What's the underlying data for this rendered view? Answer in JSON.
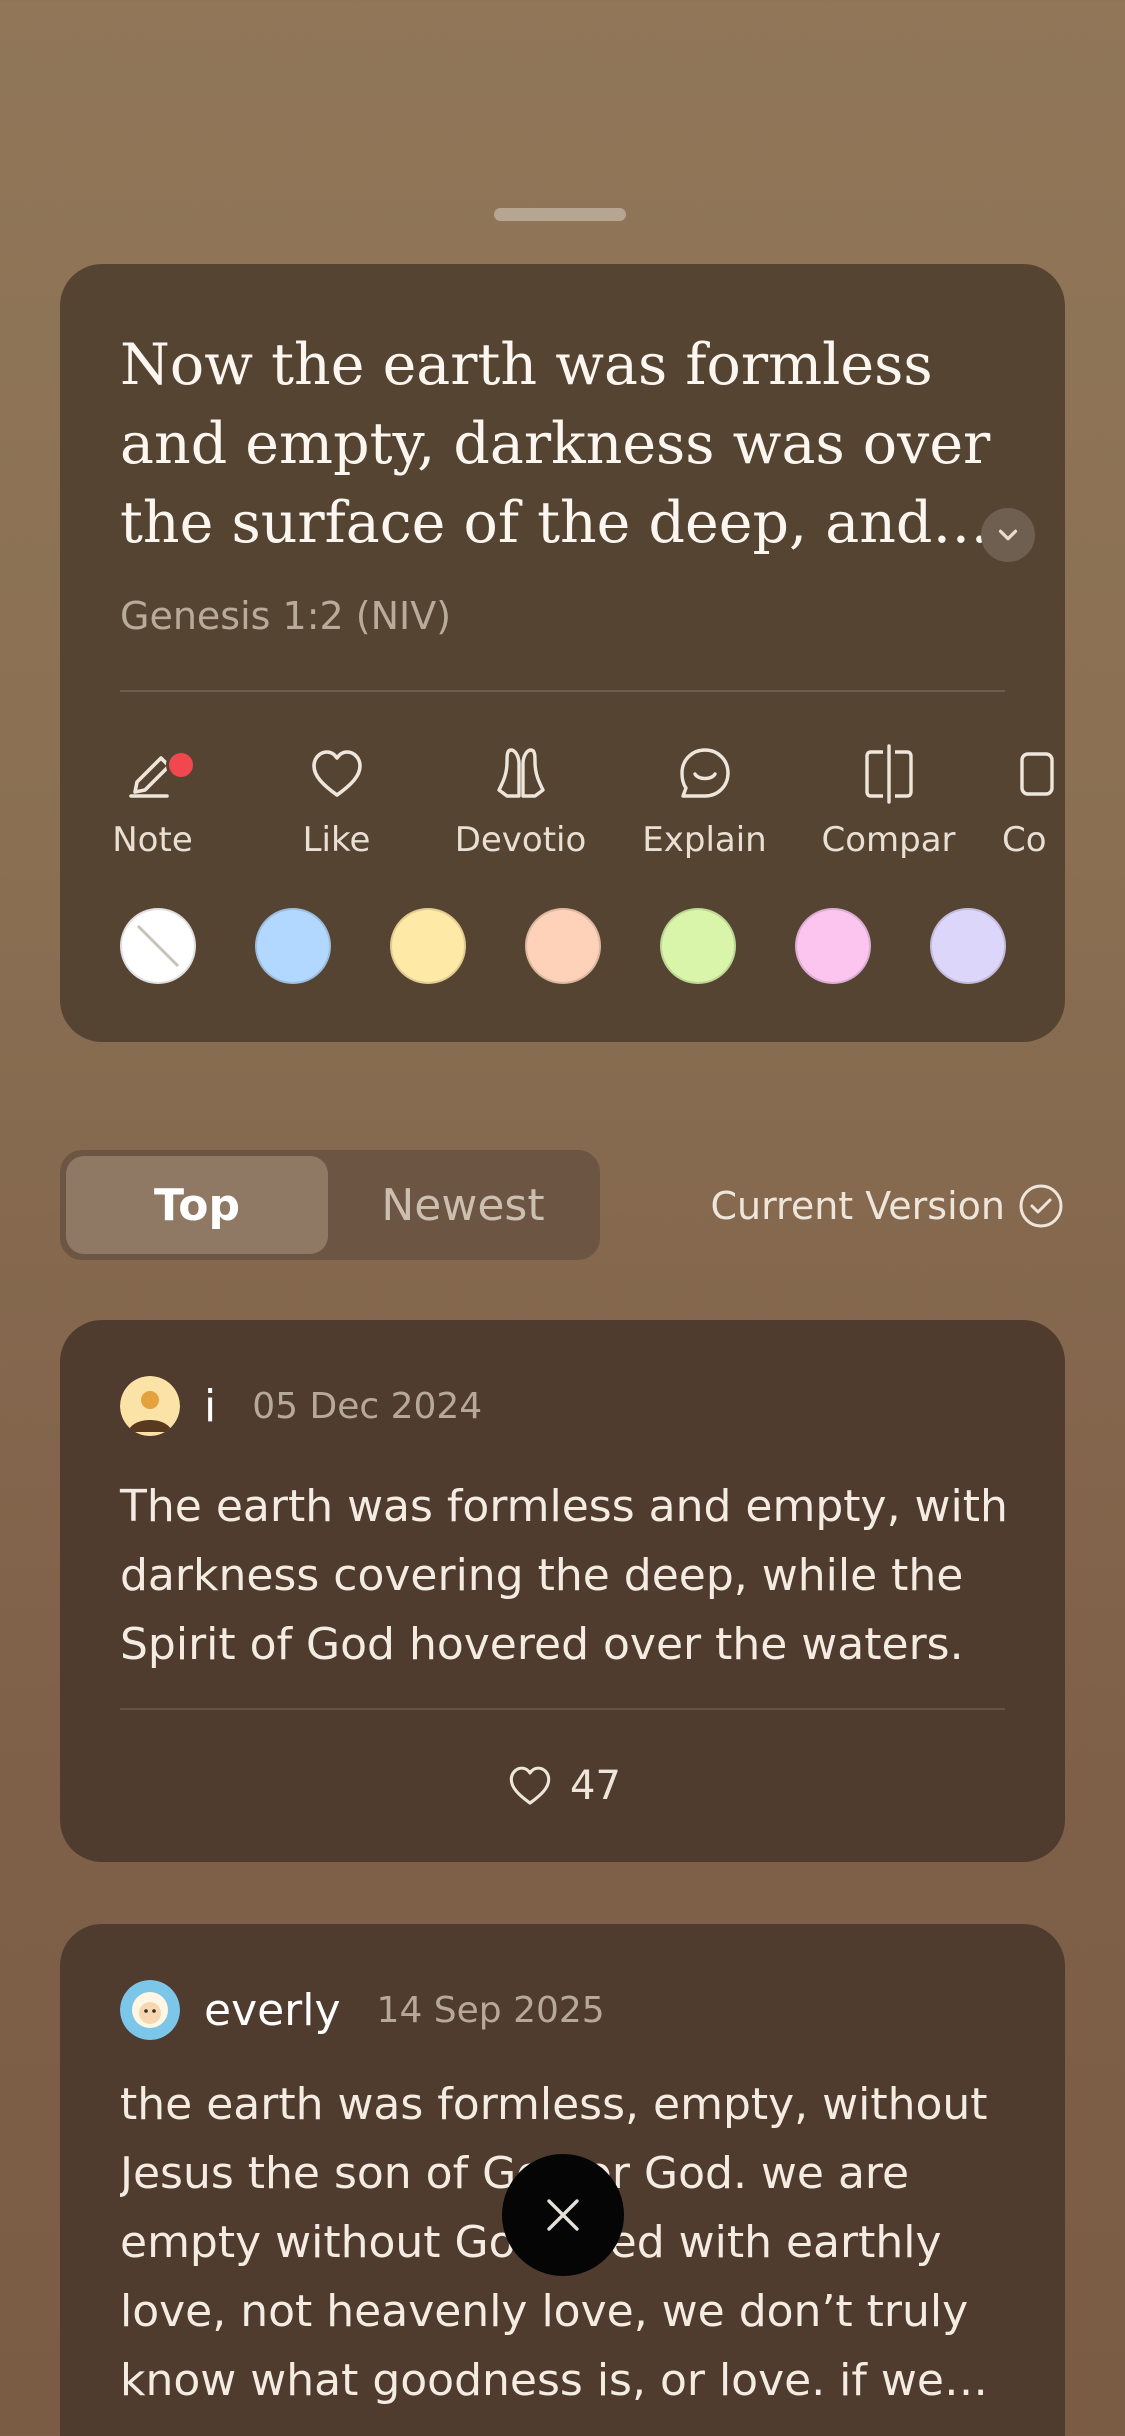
{
  "verse": {
    "text": "Now the earth was formless and empty, darkness was over the surface of the deep, and the Spirit of God was hovering over the waters.",
    "reference": "Genesis 1:2 (NIV)"
  },
  "actions": [
    {
      "label": "Note",
      "icon": "pencil-icon"
    },
    {
      "label": "Like",
      "icon": "heart-icon"
    },
    {
      "label": "Devotio",
      "icon": "praying-hands-icon"
    },
    {
      "label": "Explain",
      "icon": "smile-bubble-icon"
    },
    {
      "label": "Compar",
      "icon": "compare-icon"
    },
    {
      "label": "Co",
      "icon": "copy-icon"
    }
  ],
  "highlight_colors": [
    "none",
    "#b3d8ff",
    "#ffe9a6",
    "#fdd2b8",
    "#d8f5a9",
    "#fbc5f0",
    "#ddd6fb"
  ],
  "tabs": {
    "top": "Top",
    "newest": "Newest",
    "selected": "Top"
  },
  "version_filter": "Current Version",
  "comments": [
    {
      "user": "i",
      "date": "05 Dec 2024",
      "text": "The earth was formless and empty, with darkness covering the deep, while the Spirit of God hovered over the waters.",
      "likes": "47"
    },
    {
      "user": "everly",
      "date": "14 Sep 2025",
      "text": "the earth was formless, empty, without Jesus the son of God or God. we are empty without God filled with earthly love, not heavenly love, we don’t truly know what goodness is, or love. if we s…"
    }
  ]
}
